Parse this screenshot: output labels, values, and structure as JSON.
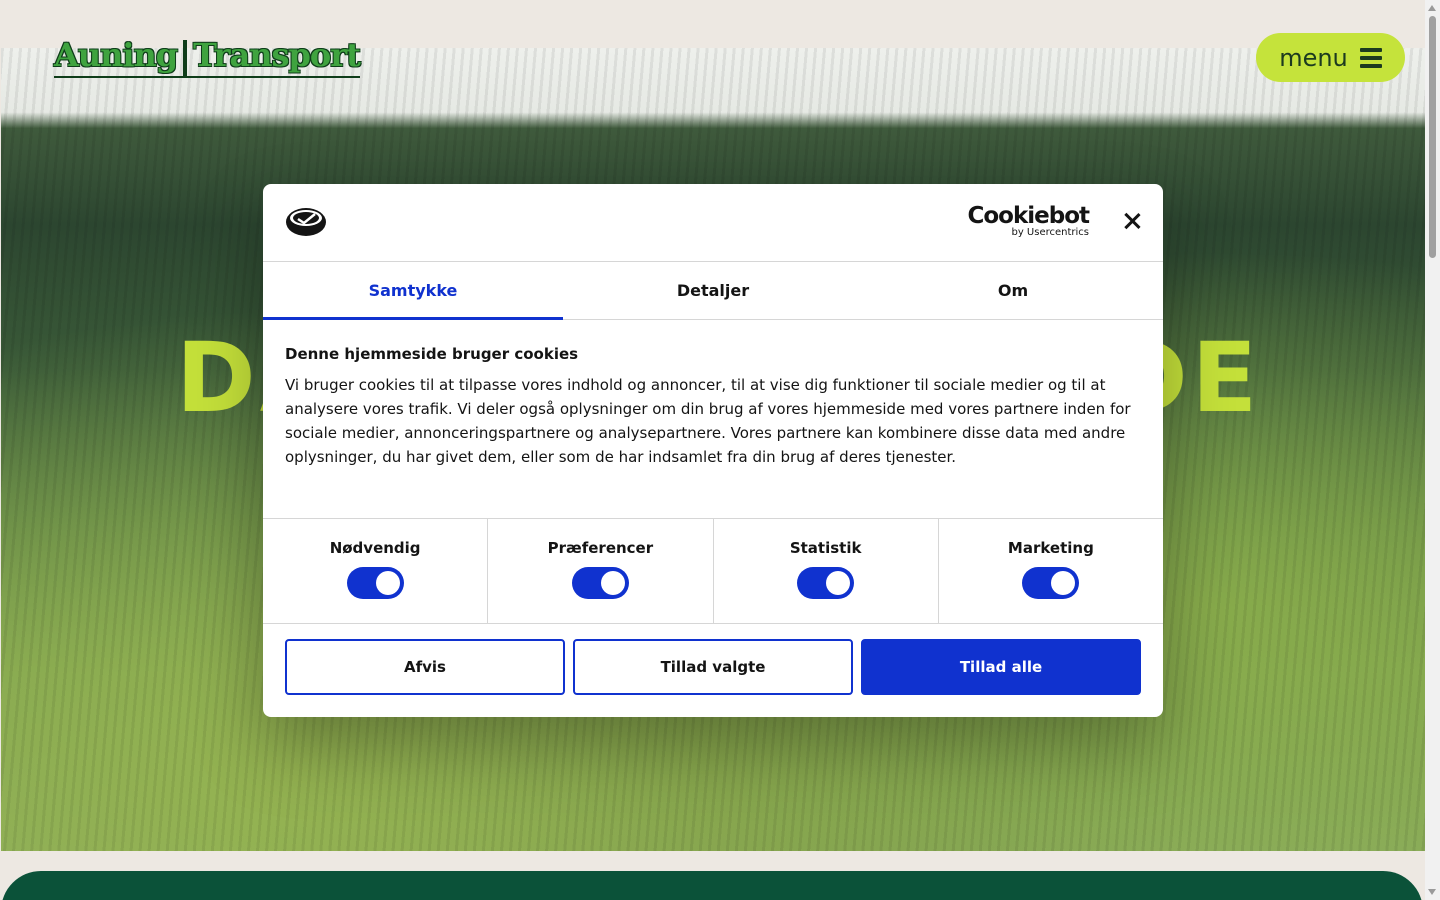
{
  "header": {
    "logo_left": "Auning",
    "logo_right": "Transport",
    "menu_label": "menu"
  },
  "hero": {
    "heading_left": "DA",
    "heading_right": "DE"
  },
  "cookie_dialog": {
    "brand_name": "Cookiebot",
    "brand_sub": "by Usercentrics",
    "tabs": [
      {
        "label": "Samtykke",
        "active": true
      },
      {
        "label": "Detaljer",
        "active": false
      },
      {
        "label": "Om",
        "active": false
      }
    ],
    "title": "Denne hjemmeside bruger cookies",
    "text": "Vi bruger cookies til at tilpasse vores indhold og annoncer, til at vise dig funktioner til sociale medier og til at analysere vores trafik. Vi deler også oplysninger om din brug af vores hjemmeside med vores partnere inden for sociale medier, annonceringspartnere og analysepartnere. Vores partnere kan kombinere disse data med andre oplysninger, du har givet dem, eller som de har indsamlet fra din brug af deres tjenester.",
    "toggles": [
      {
        "label": "Nødvendig",
        "checked": true
      },
      {
        "label": "Præferencer",
        "checked": true
      },
      {
        "label": "Statistik",
        "checked": true
      },
      {
        "label": "Marketing",
        "checked": true
      }
    ],
    "buttons": {
      "reject": "Afvis",
      "allow_selected": "Tillad valgte",
      "allow_all": "Tillad alle"
    },
    "accent_color": "#1032cf"
  },
  "colors": {
    "brand_green": "#3fa33f",
    "menu_lime": "#c5e33b",
    "footer_green": "#0b5239"
  }
}
